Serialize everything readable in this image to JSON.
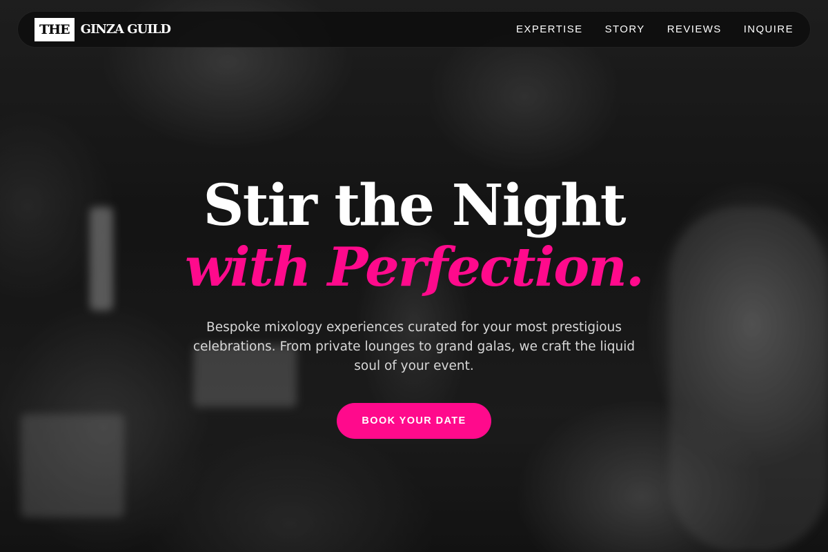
{
  "brand": {
    "box_text": "THE",
    "name": "GINZA GUILD"
  },
  "nav": {
    "links": [
      {
        "label": "EXPERTISE"
      },
      {
        "label": "STORY"
      },
      {
        "label": "REVIEWS"
      },
      {
        "label": "INQUIRE"
      }
    ]
  },
  "hero": {
    "headline_line1": "Stir the Night",
    "headline_line2": "with Perfection.",
    "subtitle": "Bespoke mixology experiences curated for your most prestigious celebrations. From private lounges to grand galas, we craft the liquid soul of your event.",
    "cta_label": "BOOK YOUR DATE"
  },
  "colors": {
    "accent": "#ff0a8c",
    "nav_background": "#0c0c0c",
    "text_primary": "#ffffff",
    "text_secondary": "#d8d8d8"
  }
}
